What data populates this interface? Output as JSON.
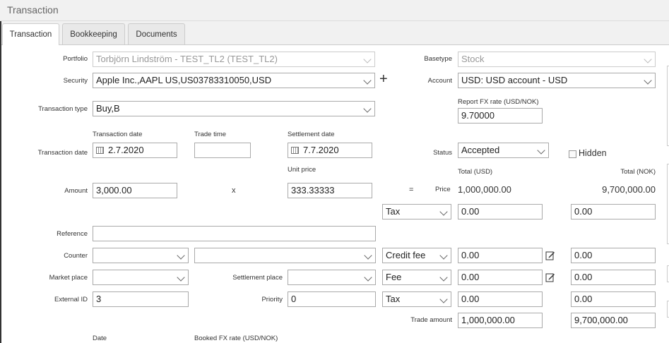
{
  "window": {
    "title": "Transaction"
  },
  "tabs": [
    {
      "label": "Transaction"
    },
    {
      "label": "Bookkeeping"
    },
    {
      "label": "Documents"
    }
  ],
  "form": {
    "portfolio": {
      "label": "Portfolio",
      "value": "Torbjörn Lindström - TEST_TL2 (TEST_TL2)"
    },
    "security": {
      "label": "Security",
      "value": "Apple Inc.,AAPL US,US03783310050,USD"
    },
    "transaction_type": {
      "label": "Transaction type",
      "value": "Buy,B"
    },
    "transaction_date": {
      "label": "Transaction date",
      "sub": "Transaction date",
      "value": "2.7.2020"
    },
    "trade_time": {
      "sub": "Trade time",
      "value": ""
    },
    "settlement_date": {
      "sub": "Settlement date",
      "value": "7.7.2020"
    },
    "amount": {
      "label": "Amount",
      "value": "3,000.00"
    },
    "times_symbol": "x",
    "unit_price": {
      "sub": "Unit price",
      "value": "333.33333"
    },
    "equals_symbol": "=",
    "reference": {
      "label": "Reference",
      "value": ""
    },
    "counter": {
      "label": "Counter",
      "value1": "",
      "value2": ""
    },
    "market_place": {
      "label": "Market place",
      "value": ""
    },
    "settlement_place": {
      "label": "Settlement place",
      "value": ""
    },
    "external_id": {
      "label": "External ID",
      "value": "3"
    },
    "priority": {
      "label": "Priority",
      "value": "0"
    },
    "date_label": "Date",
    "booked_fx_label": "Booked FX rate (USD/NOK)"
  },
  "right": {
    "basetype": {
      "label": "Basetype",
      "value": "Stock"
    },
    "account": {
      "label": "Account",
      "value": "USD: USD account - USD"
    },
    "report_fx": {
      "label": "Report FX rate (USD/NOK)",
      "value": "9.70000"
    },
    "status": {
      "label": "Status",
      "value": "Accepted"
    },
    "hidden_label": "Hidden",
    "total_usd_label": "Total (USD)",
    "total_nok_label": "Total (NOK)",
    "price_label": "Price",
    "price_usd": "1,000,000.00",
    "price_nok": "9,700,000.00",
    "fees": [
      {
        "type": "Tax",
        "usd": "0.00",
        "nok": "0.00"
      },
      {
        "type": "Credit fee",
        "usd": "0.00",
        "nok": "0.00"
      },
      {
        "type": "Fee",
        "usd": "0.00",
        "nok": "0.00"
      },
      {
        "type": "Tax",
        "usd": "0.00",
        "nok": "0.00"
      }
    ],
    "trade_amount_label": "Trade amount",
    "trade_amount_usd": "1,000,000.00",
    "trade_amount_nok": "9,700,000.00"
  }
}
